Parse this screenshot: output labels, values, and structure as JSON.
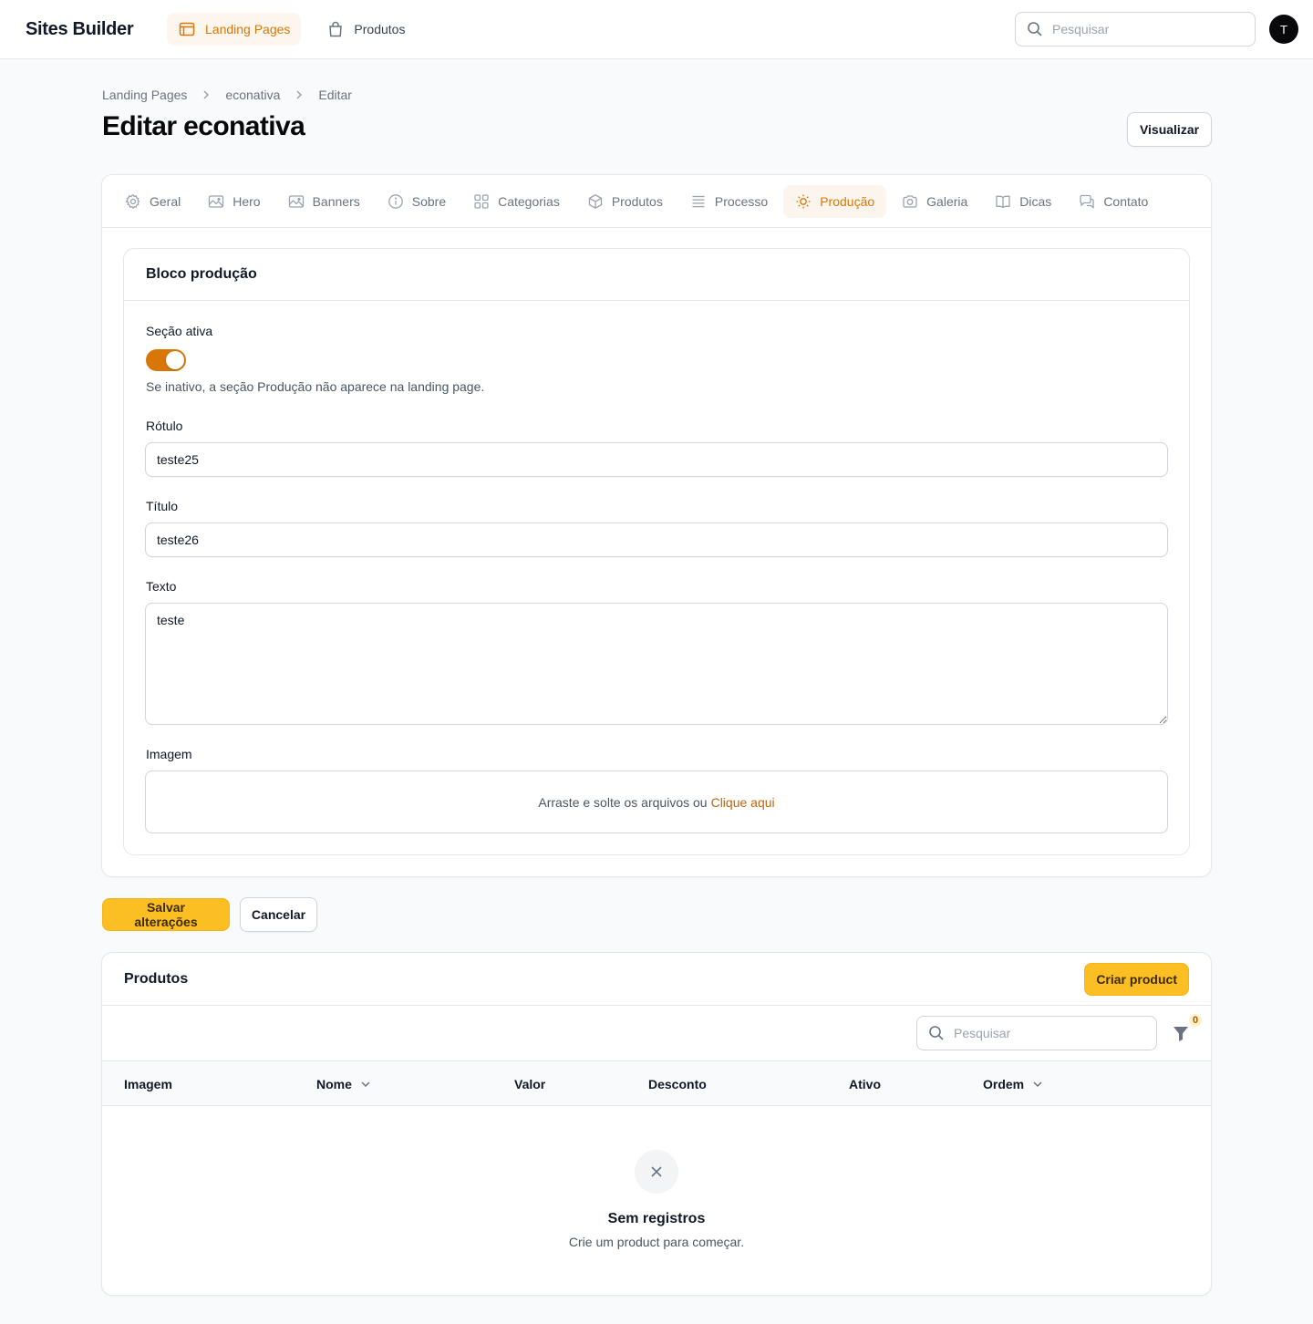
{
  "app": {
    "brand": "Sites Builder",
    "avatar_initial": "T"
  },
  "topnav": {
    "items": [
      {
        "label": "Landing Pages",
        "icon": "browser-window-icon",
        "active": true
      },
      {
        "label": "Produtos",
        "icon": "shopping-bag-icon",
        "active": false
      }
    ],
    "search_placeholder": "Pesquisar"
  },
  "breadcrumb": [
    "Landing Pages",
    "econativa",
    "Editar"
  ],
  "page": {
    "title": "Editar econativa",
    "visualizar_label": "Visualizar"
  },
  "tabs": [
    {
      "label": "Geral",
      "icon": "gear-icon"
    },
    {
      "label": "Hero",
      "icon": "image-icon"
    },
    {
      "label": "Banners",
      "icon": "image-icon"
    },
    {
      "label": "Sobre",
      "icon": "info-icon"
    },
    {
      "label": "Categorias",
      "icon": "grid-icon"
    },
    {
      "label": "Produtos",
      "icon": "cube-icon"
    },
    {
      "label": "Processo",
      "icon": "list-icon"
    },
    {
      "label": "Produção",
      "icon": "sun-icon",
      "active": true
    },
    {
      "label": "Galeria",
      "icon": "camera-icon"
    },
    {
      "label": "Dicas",
      "icon": "book-open-icon"
    },
    {
      "label": "Contato",
      "icon": "chat-bubbles-icon"
    }
  ],
  "section": {
    "title": "Bloco produção",
    "active_label": "Seção ativa",
    "active_value": true,
    "active_helper": "Se inativo, a seção Produção não aparece na landing page.",
    "rotulo_label": "Rótulo",
    "rotulo_value": "teste25",
    "titulo_label": "Título",
    "titulo_value": "teste26",
    "texto_label": "Texto",
    "texto_value": "teste",
    "imagem_label": "Imagem",
    "dropzone_text": "Arraste e solte os arquivos ou",
    "dropzone_link": "Clique aqui"
  },
  "actions": {
    "save_label": "Salvar alterações",
    "cancel_label": "Cancelar"
  },
  "produtos": {
    "title": "Produtos",
    "create_label": "Criar product",
    "search_placeholder": "Pesquisar",
    "filter_count": "0",
    "columns": [
      "Imagem",
      "Nome",
      "Valor",
      "Desconto",
      "Ativo",
      "Ordem"
    ],
    "empty_title": "Sem registros",
    "empty_desc": "Crie um product para começar."
  },
  "colors": {
    "accent": "#d97706",
    "primary_button": "#fbbf24",
    "avatar": "#09090b"
  }
}
